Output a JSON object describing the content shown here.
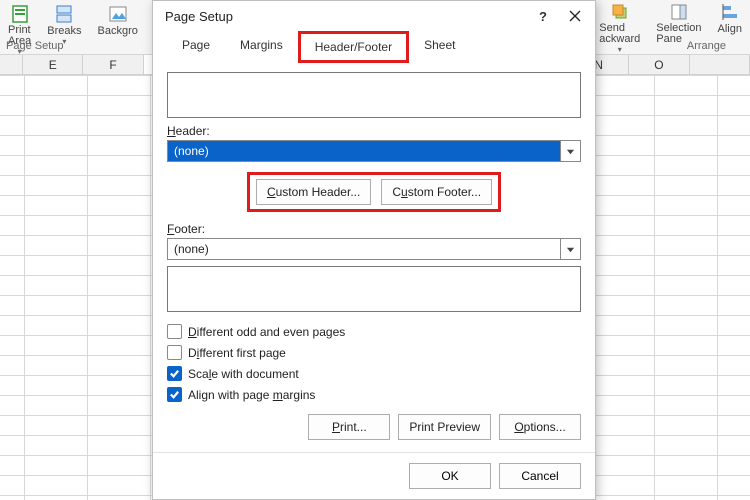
{
  "ribbon": {
    "left": {
      "printArea": "Print\nArea",
      "breaks": "Breaks",
      "background": "Backgro",
      "groupLabel": "Page Setup"
    },
    "right": {
      "send": "Send\nackward",
      "selection": "Selection\nPane",
      "align": "Align",
      "groupLabel": "Arrange"
    }
  },
  "grid": {
    "cols": [
      "",
      "E",
      "F",
      "",
      "",
      "",
      "",
      "",
      "",
      "N",
      "O",
      ""
    ]
  },
  "dialog": {
    "title": "Page Setup",
    "help": "?",
    "tabs": {
      "page": "Page",
      "margins": "Margins",
      "headerFooter": "Header/Footer",
      "sheet": "Sheet"
    },
    "headerLabel": "Header:",
    "headerValue": "(none)",
    "customHeader": "Custom Header...",
    "customFooter": "Custom Footer...",
    "footerLabel": "Footer:",
    "footerValue": "(none)",
    "checks": {
      "diffOddEven": {
        "pre": "",
        "u": "D",
        "post": "ifferent odd and even pages",
        "checked": false
      },
      "diffFirst": {
        "pre": "D",
        "u": "i",
        "post": "fferent first page",
        "checked": false
      },
      "scale": {
        "pre": "Sca",
        "u": "l",
        "post": "e with document",
        "checked": true
      },
      "alignMarg": {
        "pre": "Align with page ",
        "u": "m",
        "post": "argins",
        "checked": true
      }
    },
    "print": "Print...",
    "printPreview": "Print Preview",
    "options": "Options...",
    "ok": "OK",
    "cancel": "Cancel"
  }
}
